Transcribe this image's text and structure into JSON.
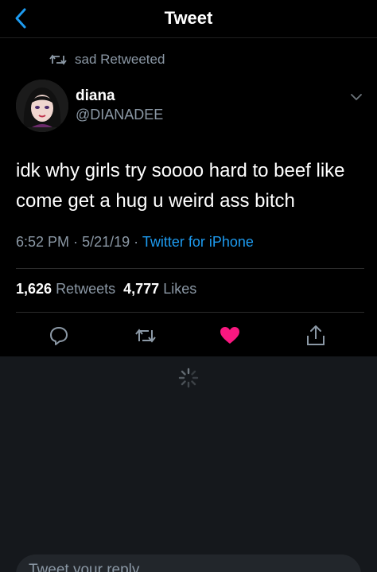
{
  "nav": {
    "title": "Tweet",
    "back_icon": "chevron-left-icon"
  },
  "retweet_context": {
    "text": "sad Retweeted",
    "icon": "retweet-icon"
  },
  "author": {
    "display_name": "diana",
    "handle": "@DIANADEE",
    "avatar": "avatar-image",
    "menu_icon": "chevron-down-icon"
  },
  "tweet": {
    "text": "idk why girls try soooo hard to beef like come get a hug u weird ass bitch",
    "time": "6:52 PM",
    "date": "5/21/19",
    "separator": "·",
    "source": "Twitter for iPhone"
  },
  "stats": {
    "retweets_count": "1,626",
    "retweets_label": "Retweets",
    "likes_count": "4,777",
    "likes_label": "Likes"
  },
  "actions": {
    "reply_icon": "reply-icon",
    "retweet_icon": "retweet-icon",
    "like_icon": "heart-filled-icon",
    "share_icon": "share-icon",
    "like_color": "#f91880"
  },
  "reply": {
    "placeholder": "Tweet your reply"
  },
  "colors": {
    "background": "#000000",
    "accent": "#1d9bf0",
    "secondary_text": "#8b98a5",
    "lower_panel": "#15181c"
  }
}
